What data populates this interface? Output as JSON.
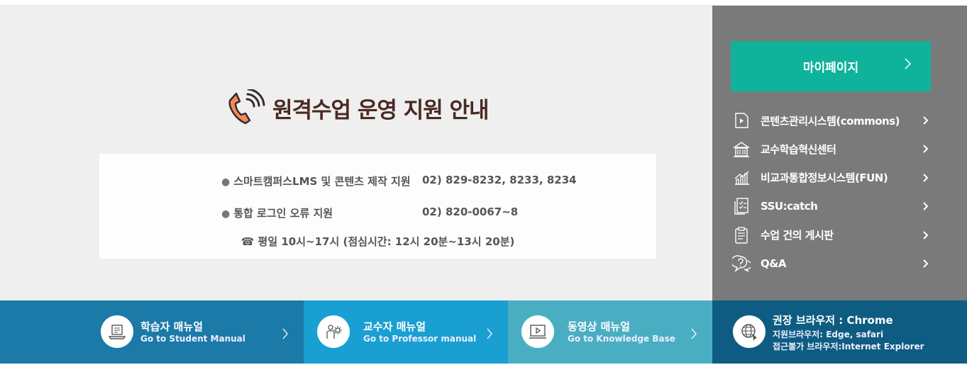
{
  "notice": {
    "title": "원격수업 운영 지원 안내",
    "rows": [
      {
        "label": "스마트캠퍼스LMS 및 콘텐츠 제작 지원",
        "phone": "02) 829-8232, 8233, 8234"
      },
      {
        "label": "통합 로그인 오류 지원",
        "phone": "02) 820-0067~8"
      }
    ],
    "hours": "☎ 평일 10시~17시  (점심시간: 12시 20분~13시 20분)"
  },
  "sidebar": {
    "mypage_label": "마이페이지",
    "items": [
      {
        "label": "콘텐츠관리시스템(commons)",
        "icon": "media-file-icon"
      },
      {
        "label": "교수학습혁신센터",
        "icon": "building-icon"
      },
      {
        "label": "비교과통합정보시스템(FUN)",
        "icon": "chart-icon"
      },
      {
        "label": "SSU:catch",
        "icon": "checklist-icon"
      },
      {
        "label": "수업 건의 게시판",
        "icon": "clipboard-icon"
      },
      {
        "label": "Q&A",
        "icon": "question-chat-icon"
      }
    ]
  },
  "manuals": [
    {
      "title": "학습자 매뉴얼",
      "subtitle": "Go to Student Manual",
      "icon": "student-laptop-icon"
    },
    {
      "title": "교수자 매뉴얼",
      "subtitle": "Go to Professor manual",
      "icon": "professor-gear-icon"
    },
    {
      "title": "동영상 매뉴얼",
      "subtitle": "Go to Knowledge Base",
      "icon": "video-player-icon"
    }
  ],
  "browser": {
    "title": "권장 브라우저 : Chrome",
    "supported": "지원브라우저: Edge, safari",
    "blocked": "접근불가 브라우저:Internet Explorer",
    "icon": "globe-icon"
  },
  "colors": {
    "mypage": "#0fb39c",
    "sidebar_bg": "#7a7a7a",
    "manual_student": "#1b7aa8",
    "manual_professor": "#199fd2",
    "manual_video": "#4aaec3",
    "browser_bg": "#0e5c82"
  }
}
